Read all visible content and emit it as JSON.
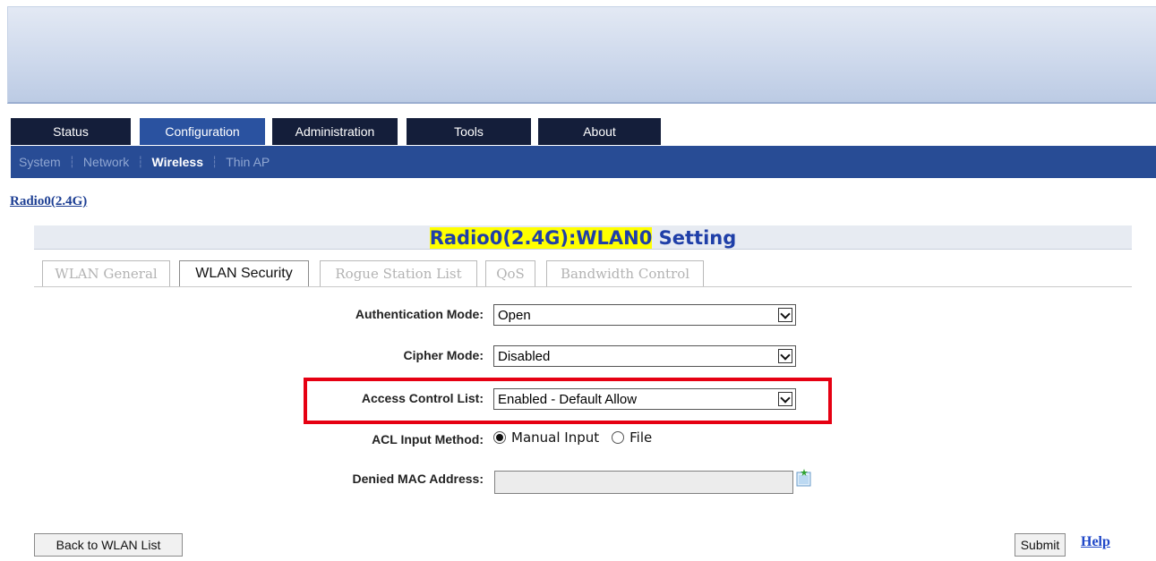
{
  "top_tabs": [
    {
      "label": "Status",
      "active": false
    },
    {
      "label": "Configuration",
      "active": true
    },
    {
      "label": "Administration",
      "active": false
    },
    {
      "label": "Tools",
      "active": false
    },
    {
      "label": "About",
      "active": false
    }
  ],
  "sub_nav": [
    {
      "label": "System",
      "active": false
    },
    {
      "label": "Network",
      "active": false
    },
    {
      "label": "Wireless",
      "active": true
    },
    {
      "label": "Thin AP",
      "active": false
    }
  ],
  "radio_link": "Radio0(2.4G)",
  "heading": {
    "highlight": "Radio0(2.4G):WLAN0",
    "rest": " Setting"
  },
  "section_tabs": [
    {
      "label": "WLAN General",
      "active": false
    },
    {
      "label": "WLAN Security",
      "active": true
    },
    {
      "label": "Rogue Station List",
      "active": false
    },
    {
      "label": "QoS",
      "active": false
    },
    {
      "label": "Bandwidth Control",
      "active": false
    }
  ],
  "form": {
    "auth_mode": {
      "label": "Authentication Mode:",
      "value": "Open"
    },
    "cipher_mode": {
      "label": "Cipher Mode:",
      "value": "Disabled"
    },
    "acl": {
      "label": "Access Control List:",
      "value": "Enabled - Default Allow"
    },
    "acl_input": {
      "label": "ACL Input Method:",
      "options": [
        "Manual Input",
        "File"
      ],
      "selected": "Manual Input"
    },
    "denied_mac": {
      "label": "Denied MAC Address:",
      "value": ""
    }
  },
  "buttons": {
    "back": "Back to WLAN List",
    "submit": "Submit",
    "help": "Help"
  },
  "colors": {
    "highlight": "#ffff00",
    "annotation_box": "#e60012",
    "nav_bar": "#284c95",
    "tab_dark": "#141e3a"
  },
  "icons": {
    "add_mac": "note-add-icon"
  }
}
